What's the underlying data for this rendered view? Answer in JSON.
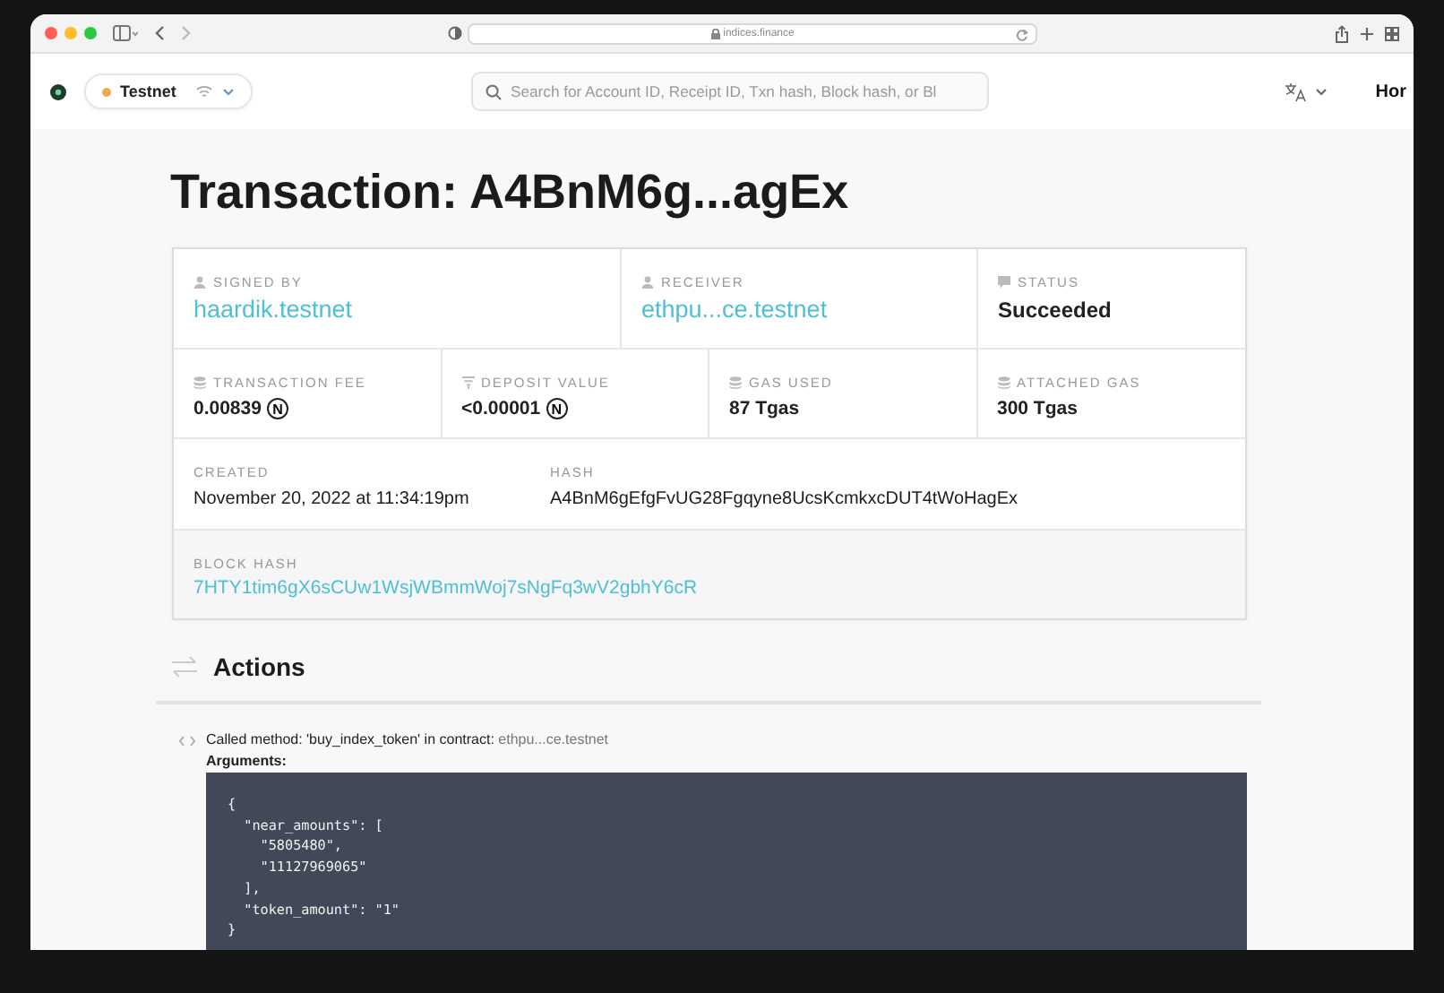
{
  "browser": {
    "url": "indices.finance"
  },
  "header": {
    "network": "Testnet",
    "search": {
      "placeholder": "Search for Account ID, Receipt ID, Txn hash, Block hash, or Bl"
    },
    "nav_link": "Hor"
  },
  "title": "Transaction: A4BnM6g...agEx",
  "summary": {
    "parties": [
      {
        "label": "SIGNED BY",
        "value": "haardik.testnet",
        "kind": "link"
      },
      {
        "label": "RECEIVER",
        "value": "ethpu...ce.testnet",
        "kind": "link"
      },
      {
        "label": "STATUS",
        "value": "Succeeded",
        "kind": "text"
      }
    ],
    "metrics": [
      {
        "label": "TRANSACTION FEE",
        "value": "0.00839",
        "kind": "near",
        "unit": "N"
      },
      {
        "label": "DEPOSIT VALUE",
        "value": "<0.00001",
        "kind": "near",
        "unit": "N"
      },
      {
        "label": "GAS USED",
        "value": "87 Tgas",
        "kind": "text"
      },
      {
        "label": "ATTACHED GAS",
        "value": "300 Tgas",
        "kind": "text"
      }
    ],
    "details": [
      {
        "label": "CREATED",
        "value": "November 20, 2022 at 11:34:19pm",
        "kind": "plain"
      },
      {
        "label": "HASH",
        "value": "A4BnM6gEfgFvUG28Fgqyne8UcsKcmkxcDUT4tWoHagEx",
        "kind": "plain"
      }
    ],
    "block_hash": {
      "label": "BLOCK HASH",
      "value": "7HTY1tim6gX6sCUw1WsjWBmmWoj7sNgFq3wV2gbhY6cR",
      "kind": "link"
    }
  },
  "actions": {
    "heading": "Actions",
    "items": [
      {
        "method_text": "Called method: 'buy_index_token' in contract:",
        "contract": "ethpu...ce.testnet",
        "arguments_label": "Arguments:",
        "arguments": "{\n  \"near_amounts\": [\n    \"5805480\",\n    \"11127969065\"\n  ],\n  \"token_amount\": \"1\"\n}"
      }
    ]
  }
}
